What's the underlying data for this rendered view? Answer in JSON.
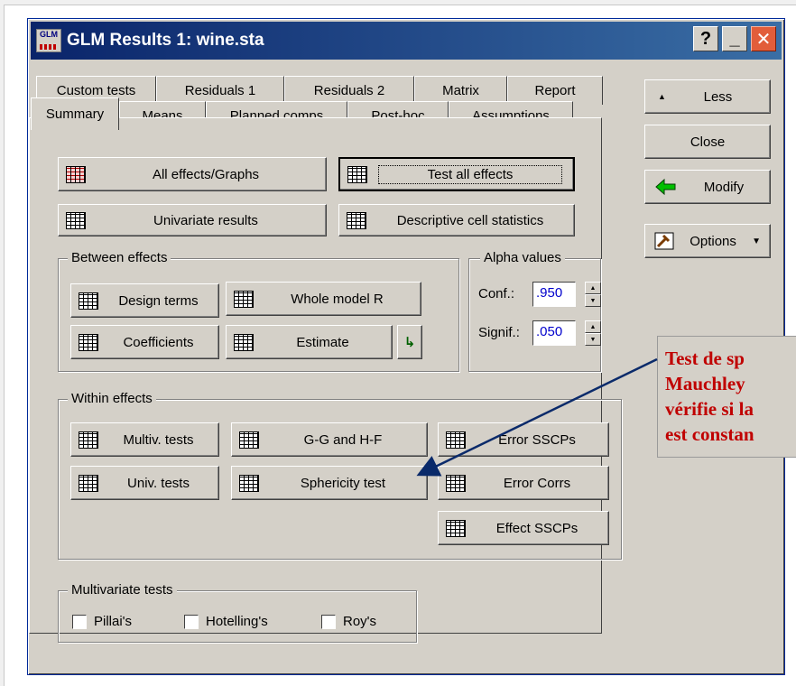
{
  "window": {
    "icon_text": "GLM",
    "title": "GLM Results 1: wine.sta",
    "help_glyph": "?",
    "minimize_glyph": "_",
    "close_glyph": "✕"
  },
  "tabs": {
    "row1": [
      "Custom tests",
      "Residuals 1",
      "Residuals 2",
      "Matrix",
      "Report"
    ],
    "row2": [
      "Summary",
      "Means",
      "Planned comps",
      "Post-hoc",
      "Assumptions"
    ]
  },
  "summary": {
    "all_effects": "All effects/Graphs",
    "test_all": "Test all effects",
    "univariate": "Univariate results",
    "descriptive": "Descriptive cell statistics"
  },
  "between": {
    "title": "Between effects",
    "design_terms": "Design terms",
    "whole_model": "Whole model R",
    "coefficients": "Coefficients",
    "estimate": "Estimate"
  },
  "alpha": {
    "title": "Alpha values",
    "conf_label": "Conf.:",
    "conf_value": ".950",
    "signif_label": "Signif.:",
    "signif_value": ".050"
  },
  "within": {
    "title": "Within effects",
    "multiv": "Multiv. tests",
    "gg_hf": "G-G and H-F",
    "error_sscps": "Error SSCPs",
    "univ": "Univ. tests",
    "sphericity": "Sphericity test",
    "error_corrs": "Error Corrs",
    "effect_sscps": "Effect SSCPs"
  },
  "multivariate": {
    "title": "Multivariate tests",
    "options": [
      "Pillai's",
      "Hotelling's",
      "Roy's"
    ]
  },
  "side": {
    "less": "Less",
    "less_glyph": "▲",
    "close": "Close",
    "modify": "Modify",
    "options": "Options",
    "options_glyph": "▼"
  },
  "annotation": {
    "lines": [
      "Test de sp",
      "Mauchley",
      "vérifie si la",
      "est constan"
    ],
    "color": "#c00000"
  }
}
